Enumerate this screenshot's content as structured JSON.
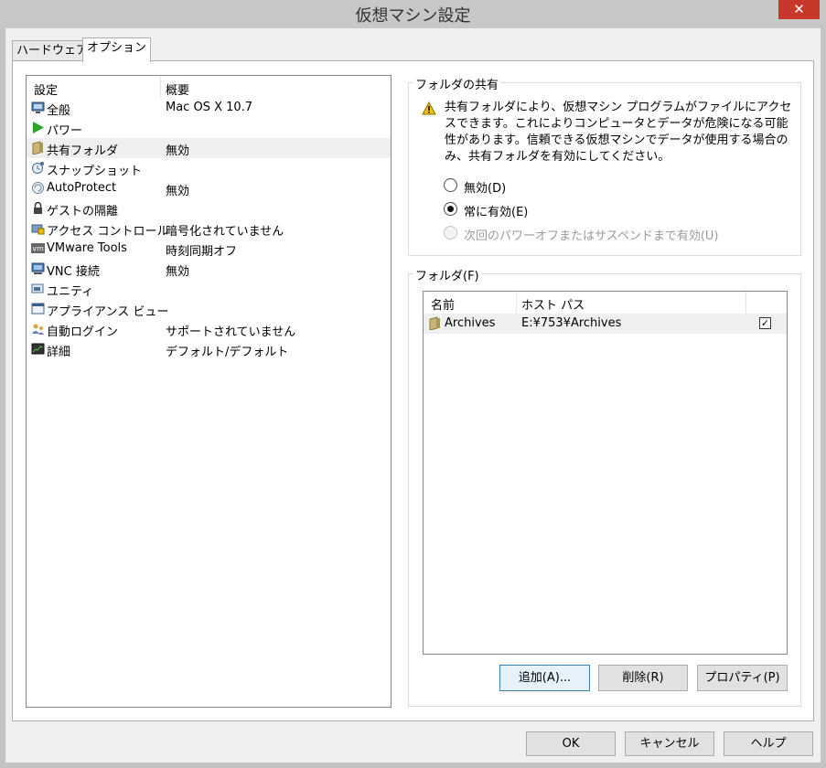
{
  "window": {
    "title": "仮想マシン設定",
    "close_glyph": "✕"
  },
  "tabs": [
    {
      "label": "ハードウェア"
    },
    {
      "label": "オプション"
    }
  ],
  "settings": {
    "header": {
      "col1": "設定",
      "col2": "概要"
    },
    "rows": [
      {
        "icon": "monitor-icon",
        "name": "全般",
        "summary": "Mac OS X 10.7"
      },
      {
        "icon": "power-play-icon",
        "name": "パワー",
        "summary": ""
      },
      {
        "icon": "shared-folder-icon",
        "name": "共有フォルダ",
        "summary": "無効"
      },
      {
        "icon": "snapshot-icon",
        "name": "スナップショット",
        "summary": ""
      },
      {
        "icon": "autoprotect-icon",
        "name": "AutoProtect",
        "summary": "無効"
      },
      {
        "icon": "guest-isolation-lock-icon",
        "name": "ゲストの隔離",
        "summary": ""
      },
      {
        "icon": "access-control-icon",
        "name": "アクセス コントロール",
        "summary": "暗号化されていません"
      },
      {
        "icon": "vmware-tools-icon",
        "name": "VMware Tools",
        "summary": "時刻同期オフ"
      },
      {
        "icon": "vnc-icon",
        "name": "VNC 接続",
        "summary": "無効"
      },
      {
        "icon": "unity-icon",
        "name": "ユニティ",
        "summary": ""
      },
      {
        "icon": "appliance-view-icon",
        "name": "アプライアンス ビュー",
        "summary": ""
      },
      {
        "icon": "autologin-users-icon",
        "name": "自動ログイン",
        "summary": "サポートされていません"
      },
      {
        "icon": "advanced-icon",
        "name": "詳細",
        "summary": "デフォルト/デフォルト"
      }
    ]
  },
  "folder_sharing": {
    "legend": "フォルダの共有",
    "warning": "共有フォルダにより、仮想マシン プログラムがファイルにアクセスできます。これによりコンピュータとデータが危険になる可能性があります。信頼できる仮想マシンでデータが使用する場合のみ、共有フォルダを有効にしてください。",
    "options": [
      {
        "label": "無効(D)"
      },
      {
        "label": "常に有効(E)"
      },
      {
        "label": "次回のパワーオフまたはサスペンドまで有効(U)"
      }
    ]
  },
  "folders": {
    "legend": "フォルダ(F)",
    "header": {
      "name": "名前",
      "host_path": "ホスト パス"
    },
    "rows": [
      {
        "name": "Archives",
        "path": "E:¥753¥Archives",
        "enabled_glyph": "✓"
      }
    ],
    "buttons": {
      "add": "追加(A)...",
      "remove": "削除(R)",
      "properties": "プロパティ(P)"
    }
  },
  "dialog_buttons": {
    "ok": "OK",
    "cancel": "キャンセル",
    "help": "ヘルプ"
  },
  "colors": {
    "close_button": "#c7372a",
    "selection": "#efefef",
    "power_green": "#2da52d",
    "warning_yellow": "#f2c200"
  }
}
